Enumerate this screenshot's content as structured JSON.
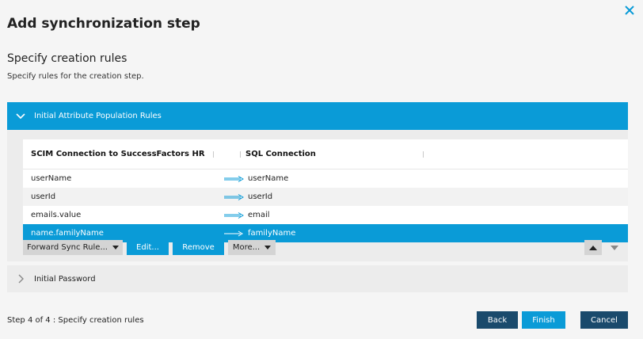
{
  "dialog": {
    "title": "Add synchronization step",
    "section_title": "Specify creation rules",
    "section_desc": "Specify rules for the creation step."
  },
  "accordion_rules": {
    "label": "Initial Attribute Population Rules",
    "expanded": true
  },
  "grid": {
    "headers": {
      "left": "SCIM Connection to SuccessFactors HR",
      "right": "SQL Connection"
    },
    "rows": [
      {
        "source": "userName",
        "target": "userName",
        "selected": false
      },
      {
        "source": "userId",
        "target": "userId",
        "selected": false
      },
      {
        "source": "emails.value",
        "target": "email",
        "selected": false
      },
      {
        "source": "name.familyName",
        "target": "familyName",
        "selected": true
      }
    ]
  },
  "toolbar": {
    "forward_sync_label": "Forward Sync Rule...",
    "edit_label": "Edit...",
    "remove_label": "Remove",
    "more_label": "More..."
  },
  "accordion_password": {
    "label": "Initial Password",
    "expanded": false
  },
  "footer": {
    "status": "Step 4 of 4 : Specify creation rules",
    "back_label": "Back",
    "finish_label": "Finish",
    "cancel_label": "Cancel"
  },
  "colors": {
    "accent": "#0a9bd7",
    "dark_button": "#1a4a6c",
    "panel": "#ececec"
  }
}
